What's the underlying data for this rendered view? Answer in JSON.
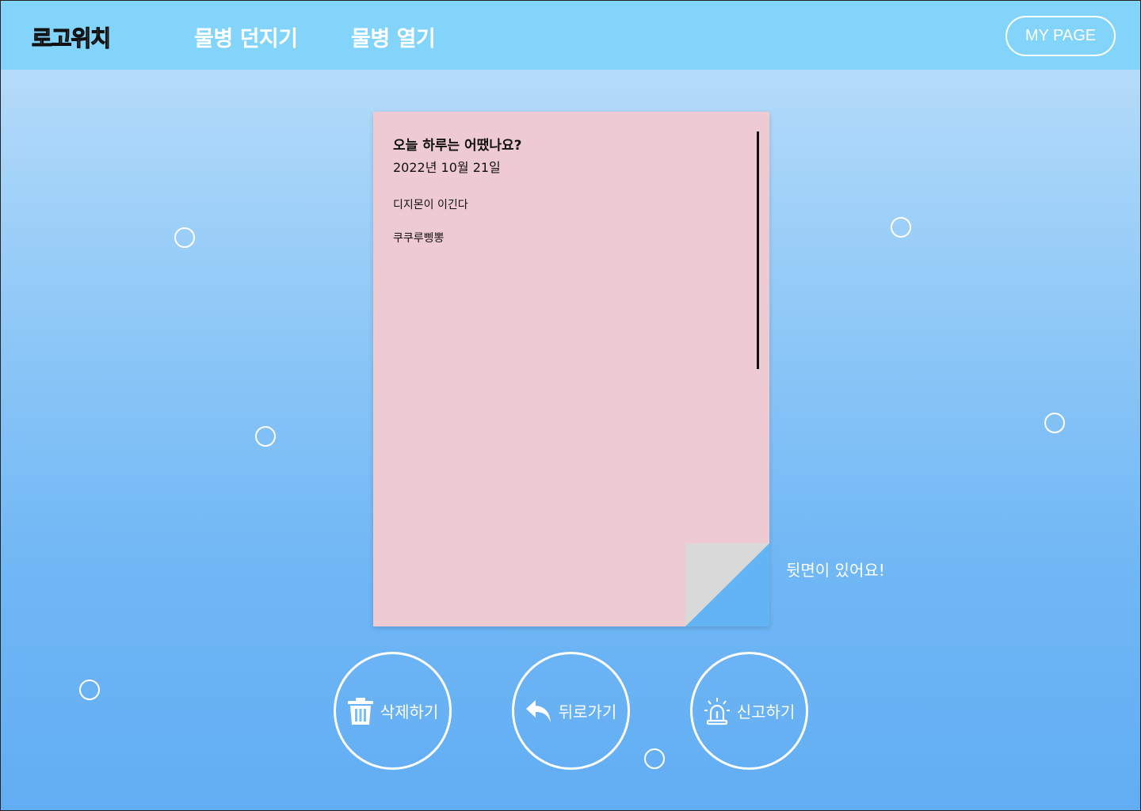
{
  "header": {
    "logo": "로고위치",
    "nav": {
      "throw": "물병 던지기",
      "open": "물병 열기"
    },
    "my_page": "MY PAGE"
  },
  "letter": {
    "title": "오늘 하루는 어땠나요?",
    "date": "2022년 10월 21일",
    "lines": [
      "디지몬이 이긴다",
      "쿠쿠루삥뽕"
    ],
    "flip_hint": "뒷면이 있어요!"
  },
  "actions": {
    "delete": "삭제하기",
    "back": "뒤로가기",
    "report": "신고하기"
  },
  "colors": {
    "header": "#82d4fb",
    "letter": "#eecbd2",
    "corner_fold": "#d9d9d9",
    "corner_accent": "#62b4f4"
  },
  "icons": {
    "delete": "trash-icon",
    "back": "reply-arrow-icon",
    "report": "siren-icon"
  }
}
